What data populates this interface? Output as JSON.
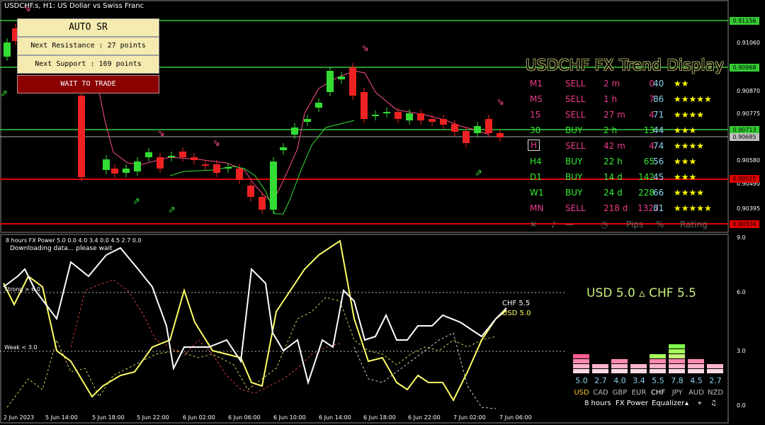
{
  "chart": {
    "symbol_title": "USDCHF.s, H1:  US Dollar vs Swiss Franc",
    "price_axis": [
      "0.91060",
      "0.90870",
      "0.90775",
      "0.90580",
      "0.90490",
      "0.90395"
    ],
    "price_axis_top": "0.91156",
    "price_tags": [
      {
        "text": "0.91156",
        "color": "#33cc33"
      },
      {
        "text": "0.90968",
        "color": "#33cc33"
      },
      {
        "text": "0.90713",
        "color": "#33cc33"
      },
      {
        "text": "0.90685",
        "color": "#c0c0c0"
      },
      {
        "text": "0.90515",
        "color": "#e00000"
      },
      {
        "text": "0.90334",
        "color": "#e00000"
      }
    ],
    "time_axis": [
      "2 Jun 2023",
      "5 Jun 14:00",
      "5 Jun 18:00",
      "5 Jun 22:00",
      "6 Jun 02:00",
      "6 Jun 06:00",
      "6 Jun 10:00",
      "6 Jun 14:00",
      "6 Jun 18:00",
      "6 Jun 22:00",
      "7 Jun 02:00",
      "7 Jun 06:00"
    ]
  },
  "auto_sr": {
    "title": "AUTO SR",
    "next_resistance": "Next Resistance : 27 points",
    "next_support": "Next Support : 169 points",
    "status": "WAIT TO TRADE"
  },
  "trend_display": {
    "title": "USDCHF FX Trend Display",
    "rows": [
      {
        "tf": "M1",
        "dir": "SELL",
        "time": "2 m",
        "pips": "0",
        "pct": "40",
        "stars": "★★"
      },
      {
        "tf": "M5",
        "dir": "SELL",
        "time": "1 h",
        "pips": "7",
        "pct": "86",
        "stars": "★★★★★"
      },
      {
        "tf": "15",
        "dir": "SELL",
        "time": "27 m",
        "pips": "4",
        "pct": "71",
        "stars": "★★★★"
      },
      {
        "tf": "30",
        "dir": "BUY",
        "time": "2 h",
        "pips": "13",
        "pct": "44",
        "stars": "★★★"
      },
      {
        "tf": "H",
        "dir": "SELL",
        "time": "42 m",
        "pips": "4",
        "pct": "74",
        "stars": "★★★★"
      },
      {
        "tf": "H4",
        "dir": "BUY",
        "time": "22 h",
        "pips": "65",
        "pct": "56",
        "stars": "★★★"
      },
      {
        "tf": "D1",
        "dir": "BUY",
        "time": "14 d",
        "pips": "142",
        "pct": "45",
        "stars": "★★★"
      },
      {
        "tf": "W1",
        "dir": "BUY",
        "time": "24 d",
        "pips": "228",
        "pct": "66",
        "stars": "★★★★"
      },
      {
        "tf": "MN",
        "dir": "SELL",
        "time": "218 d",
        "pips": "1327",
        "pct": "81",
        "stars": "★★★★★"
      }
    ],
    "footer": {
      "close": "✕",
      "pips": "Pips",
      "pct": "%",
      "rating": "Rating"
    }
  },
  "power": {
    "title": "8 hours FX Power 5.0 0.0 4.0 3.4 0.0 4.5 2.7 0.0",
    "note": "Downloading data... please wait",
    "strong_label": "Strong > 6.0",
    "weak_label": "Weak < 3.0",
    "axis": [
      "9.0",
      "6.0",
      "3.0",
      "0.0"
    ],
    "legend_chf": "CHF 5.5",
    "legend_usd": "USD 5.0",
    "pair_strength": "USD 5.0  ▵  CHF 5.5"
  },
  "equalizer": {
    "currencies": [
      {
        "code": "USD",
        "value": 5.0,
        "label": "5.0"
      },
      {
        "code": "CAD",
        "value": 2.7,
        "label": "2.7"
      },
      {
        "code": "GBP",
        "value": 4.0,
        "label": "4.0"
      },
      {
        "code": "EUR",
        "value": 3.4,
        "label": "3.4"
      },
      {
        "code": "CHF",
        "value": 5.5,
        "label": "5.5"
      },
      {
        "code": "JPY",
        "value": 7.8,
        "label": "7.8"
      },
      {
        "code": "AUD",
        "value": 4.5,
        "label": "4.5"
      },
      {
        "code": "NZD",
        "value": 2.7,
        "label": "2.7"
      }
    ],
    "footer_period": "8 hours",
    "footer_name": "FX Power",
    "footer_mode": "Equalizer"
  },
  "colors": {
    "buy": "#33dd33",
    "sell": "#ee2222",
    "resistance": "#33cc33",
    "support": "#e00000",
    "sell_text": "#ee3b8c",
    "buy_text": "#33ee33",
    "usd": "#ffff66",
    "chf": "#ffffff"
  }
}
